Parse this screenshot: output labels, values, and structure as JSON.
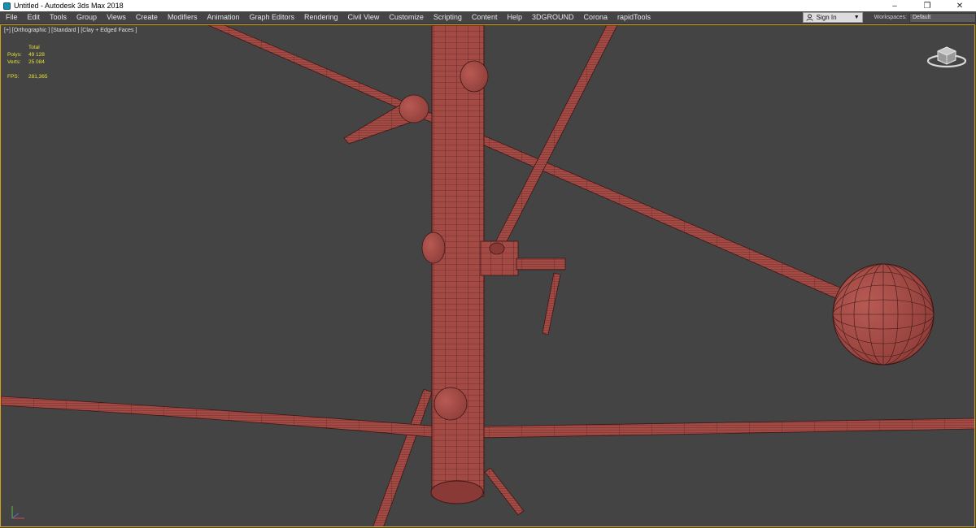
{
  "window": {
    "title": "Untitled - Autodesk 3ds Max 2018",
    "controls": [
      "–",
      "❐",
      "✕"
    ]
  },
  "menu": {
    "items": [
      "File",
      "Edit",
      "Tools",
      "Group",
      "Views",
      "Create",
      "Modifiers",
      "Animation",
      "Graph Editors",
      "Rendering",
      "Civil View",
      "Customize",
      "Scripting",
      "Content",
      "Help",
      "3DGROUND",
      "Corona",
      "rapidTools"
    ],
    "sign_in_label": "Sign In",
    "workspaces_label": "Workspaces:",
    "workspaces_value": "Default"
  },
  "viewport": {
    "label": "[+] [Orthographic ] [Standard ] [Clay + Edged Faces ]",
    "stats": {
      "header": "Total",
      "polys_label": "Polys:",
      "polys_value": "49 128",
      "verts_label": "Verts:",
      "verts_value": "25 084",
      "fps_label": "FPS:",
      "fps_value": "281,365"
    }
  },
  "colors": {
    "viewport_bg": "#444444",
    "mesh_fill": "#a34a45",
    "mesh_edge": "#3d1715",
    "stats_text": "#e6e034",
    "active_border": "#d5a019"
  }
}
